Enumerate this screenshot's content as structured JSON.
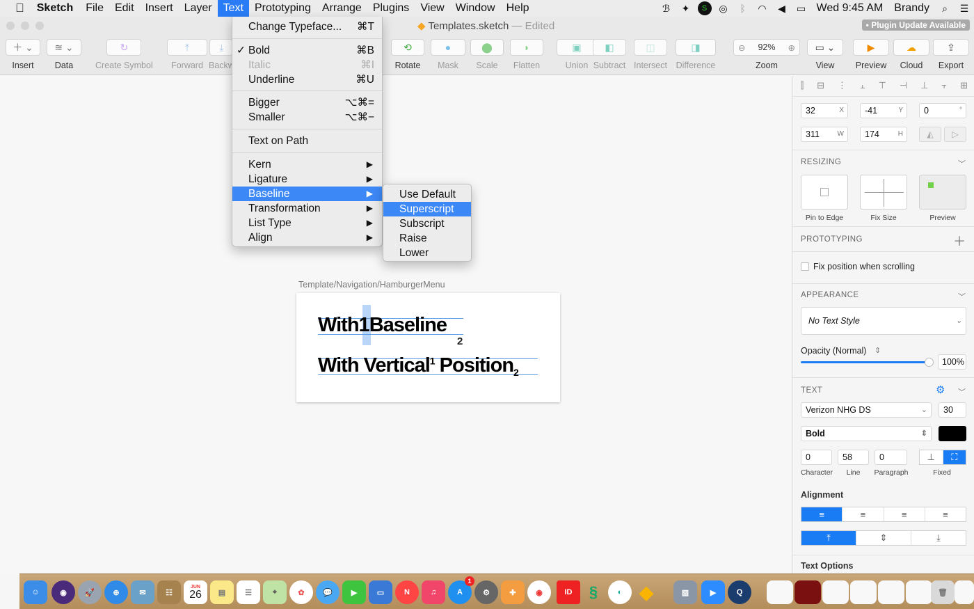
{
  "menubar": {
    "apple": "",
    "app_name": "Sketch",
    "items": [
      "File",
      "Edit",
      "Insert",
      "Layer",
      "Text",
      "Prototyping",
      "Arrange",
      "Plugins",
      "View",
      "Window",
      "Help"
    ],
    "active_item": "Text",
    "clock": "Wed 9:45 AM",
    "user": "Brandy"
  },
  "window": {
    "doc_name": "Templates.sketch",
    "doc_state": "— Edited",
    "plugin_badge": "• Plugin Update Available"
  },
  "toolbar": {
    "insert": "Insert",
    "data": "Data",
    "create_symbol": "Create Symbol",
    "forward": "Forward",
    "backward": "Backw",
    "rotate": "Rotate",
    "mask": "Mask",
    "scale": "Scale",
    "flatten": "Flatten",
    "union": "Union",
    "subtract": "Subtract",
    "intersect": "Intersect",
    "difference": "Difference",
    "zoom_value": "92%",
    "zoom": "Zoom",
    "view": "View",
    "preview": "Preview",
    "cloud": "Cloud",
    "export": "Export"
  },
  "text_menu": {
    "change_typeface": "Change Typeface...",
    "change_typeface_sc": "⌘T",
    "bold": "Bold",
    "bold_sc": "⌘B",
    "italic": "Italic",
    "italic_sc": "⌘I",
    "underline": "Underline",
    "underline_sc": "⌘U",
    "bigger": "Bigger",
    "bigger_sc": "⌥⌘=",
    "smaller": "Smaller",
    "smaller_sc": "⌥⌘−",
    "text_on_path": "Text on Path",
    "kern": "Kern",
    "ligature": "Ligature",
    "baseline": "Baseline",
    "transformation": "Transformation",
    "list_type": "List Type",
    "align": "Align"
  },
  "baseline_submenu": [
    "Use Default",
    "Superscript",
    "Subscript",
    "Raise",
    "Lower"
  ],
  "baseline_highlighted": "Superscript",
  "canvas": {
    "artboard_label": "Template/Navigation/HamburgerMenu",
    "line1_a": "With",
    "line1_b": "1",
    "line1_c": "Baseline",
    "line1_sub": "2",
    "line2_a": "With Vertical",
    "line2_sup": "1",
    "line2_b": " Position",
    "line2_sub": "2"
  },
  "inspector": {
    "x": "32",
    "x_lbl": "X",
    "y": "-41",
    "y_lbl": "Y",
    "rot": "0",
    "rot_lbl": "°",
    "w": "311",
    "w_lbl": "W",
    "h": "174",
    "h_lbl": "H",
    "resizing": "RESIZING",
    "pin_to_edge": "Pin to Edge",
    "fix_size": "Fix Size",
    "preview": "Preview",
    "prototyping": "PROTOTYPING",
    "fix_position": "Fix position when scrolling",
    "appearance": "APPEARANCE",
    "text_style": "No Text Style",
    "opacity_label": "Opacity (Normal)",
    "opacity_value": "100%",
    "opacity_level": 1.0,
    "text": "TEXT",
    "font": "Verizon NHG DS",
    "font_size": "30",
    "weight": "Bold",
    "character": "0",
    "line": "58",
    "paragraph": "0",
    "character_lbl": "Character",
    "line_lbl": "Line",
    "paragraph_lbl": "Paragraph",
    "fixed_lbl": "Fixed",
    "alignment": "Alignment",
    "text_options": "Text Options"
  },
  "dock": {
    "calendar_month": "JUN",
    "calendar_day": "26",
    "badge": "1",
    "universal_id": "ID"
  },
  "colors": {
    "accent": "#2a7cf6",
    "highlight": "#3d88f7"
  }
}
